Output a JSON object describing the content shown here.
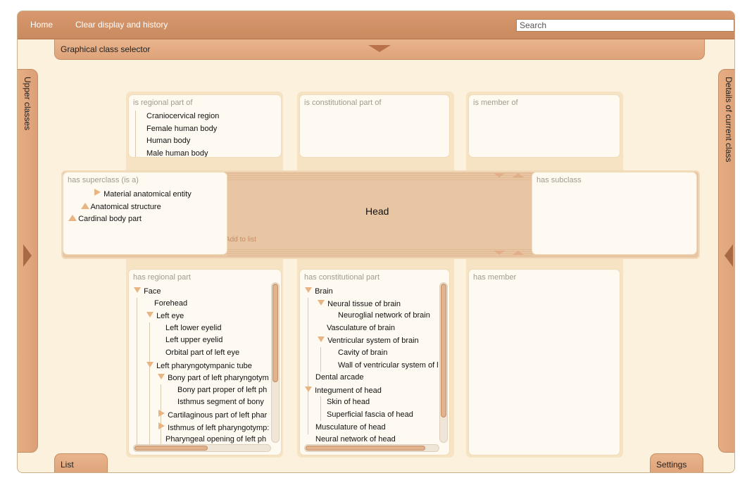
{
  "topbar": {
    "home": "Home",
    "clear": "Clear display and history",
    "search_placeholder": "Search"
  },
  "selector_bar": {
    "label": "Graphical class selector"
  },
  "side_tabs": {
    "left": "Upper classes",
    "right": "Details of current class"
  },
  "bottom_tabs": {
    "list": "List",
    "settings": "Settings"
  },
  "current_class": {
    "name": "Head",
    "add_to_list": "Add to list"
  },
  "panels": {
    "is_regional_part_of": {
      "title": "is regional part of",
      "items": [
        "Craniocervical region",
        "Female human body",
        "Human body",
        "Male human body"
      ]
    },
    "is_constitutional_part_of": {
      "title": "is constitutional part of"
    },
    "is_member_of": {
      "title": "is member of"
    },
    "has_superclass": {
      "title": "has superclass (is a)",
      "items": [
        "Material anatomical entity",
        "Anatomical structure",
        "Cardinal body part"
      ]
    },
    "has_subclass": {
      "title": "has subclass"
    },
    "has_regional_part": {
      "title": "has regional part",
      "items": [
        "Face",
        "Forehead",
        "Left eye",
        "Left lower eyelid",
        "Left upper eyelid",
        "Orbital part of left eye",
        "Left pharyngotympanic tube",
        "Bony part of left pharyngotym",
        "Bony part proper of left ph",
        "Isthmus segment of bony",
        "Cartilaginous part of left phar",
        "Isthmus of left pharyngotymp:",
        "Pharyngeal opening of left ph"
      ]
    },
    "has_constitutional_part": {
      "title": "has constitutional part",
      "items": [
        "Brain",
        "Neural tissue of brain",
        "Neuroglial network of brain",
        "Vasculature of brain",
        "Ventricular system of brain",
        "Cavity of brain",
        "Wall of ventricular system of l",
        "Dental arcade",
        "Integument of head",
        "Skin of head",
        "Superficial fascia of head",
        "Musculature of head",
        "Neural network of head"
      ]
    },
    "has_member": {
      "title": "has member"
    }
  },
  "colors": {
    "topbar": "#cf8f63",
    "panel_bg": "#fffaf1",
    "band": "#e9c6a3",
    "triangle": "#e7b584"
  }
}
